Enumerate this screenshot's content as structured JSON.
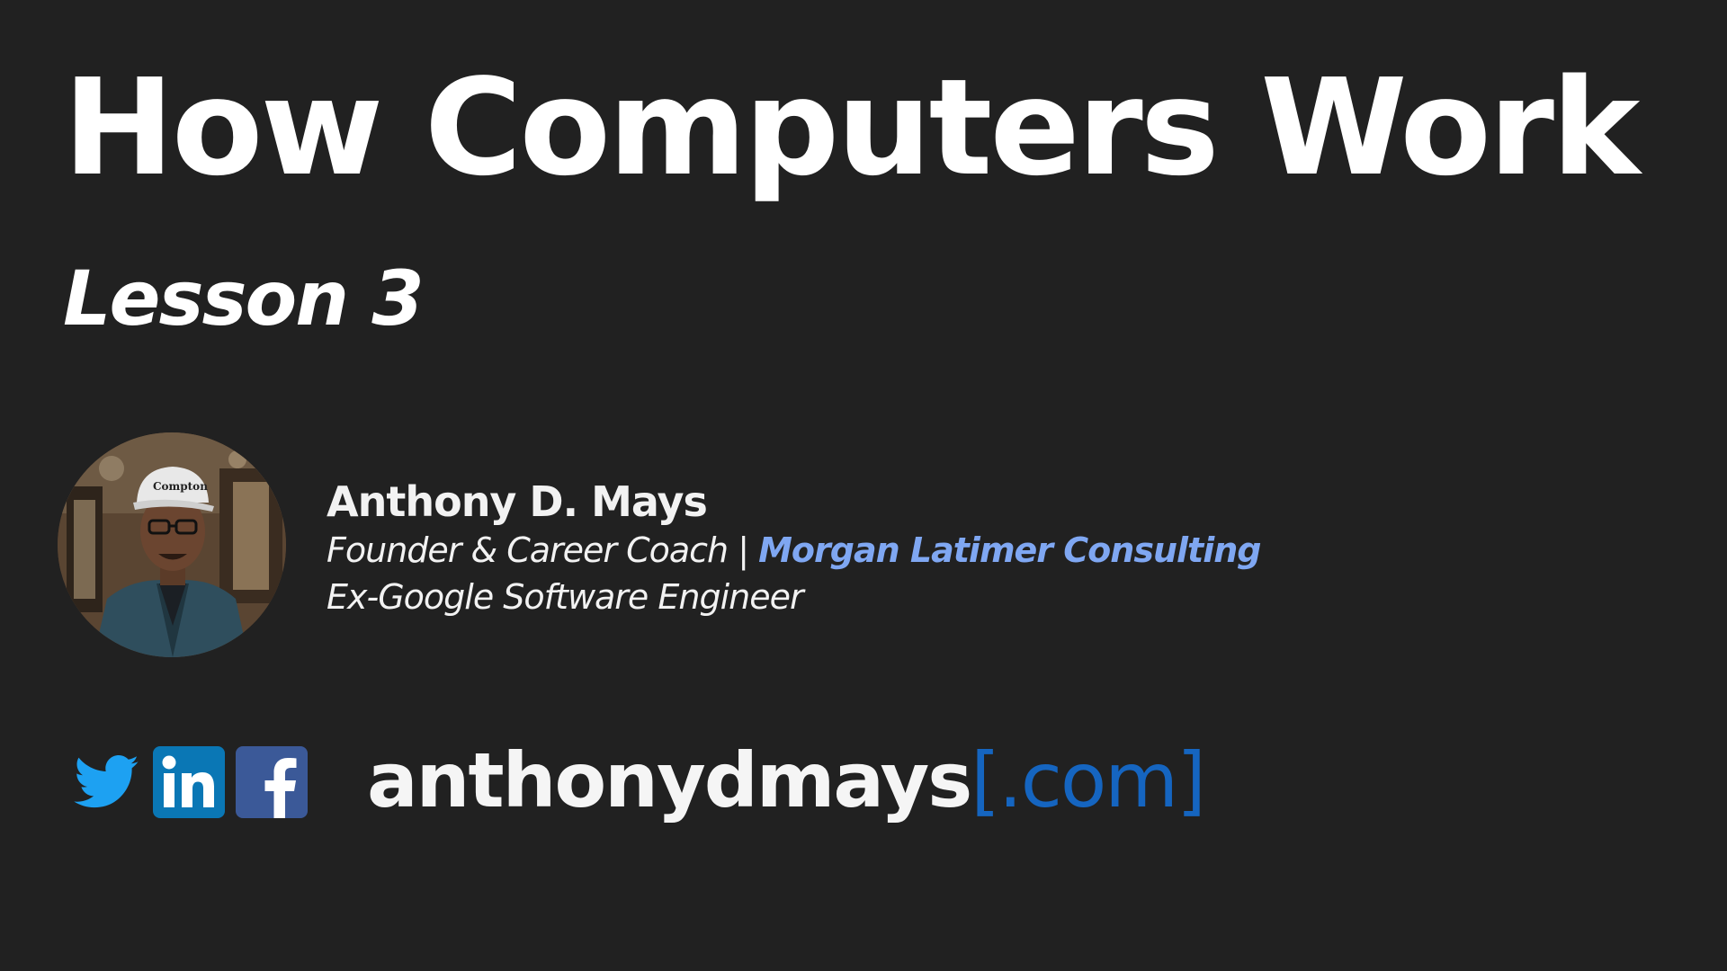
{
  "slide": {
    "title": "How Computers Work",
    "subtitle": "Lesson 3"
  },
  "author": {
    "name": "Anthony D. Mays",
    "role_prefix": "Founder & Career Coach | ",
    "company": "Morgan Latimer Consulting",
    "previous_role": "Ex-Google Software Engineer",
    "photo_icon": "author-photo"
  },
  "social": {
    "icons": [
      "twitter-icon",
      "linkedin-icon",
      "facebook-icon"
    ],
    "website_name": "anthonydmays",
    "website_suffix": "[.com]"
  },
  "colors": {
    "background": "#212121",
    "text": "#ffffff",
    "company_link": "#7fa7f2",
    "domain_suffix": "#1565c0",
    "twitter": "#1da1f2",
    "linkedin": "#0a77b5",
    "facebook": "#3b5998"
  }
}
